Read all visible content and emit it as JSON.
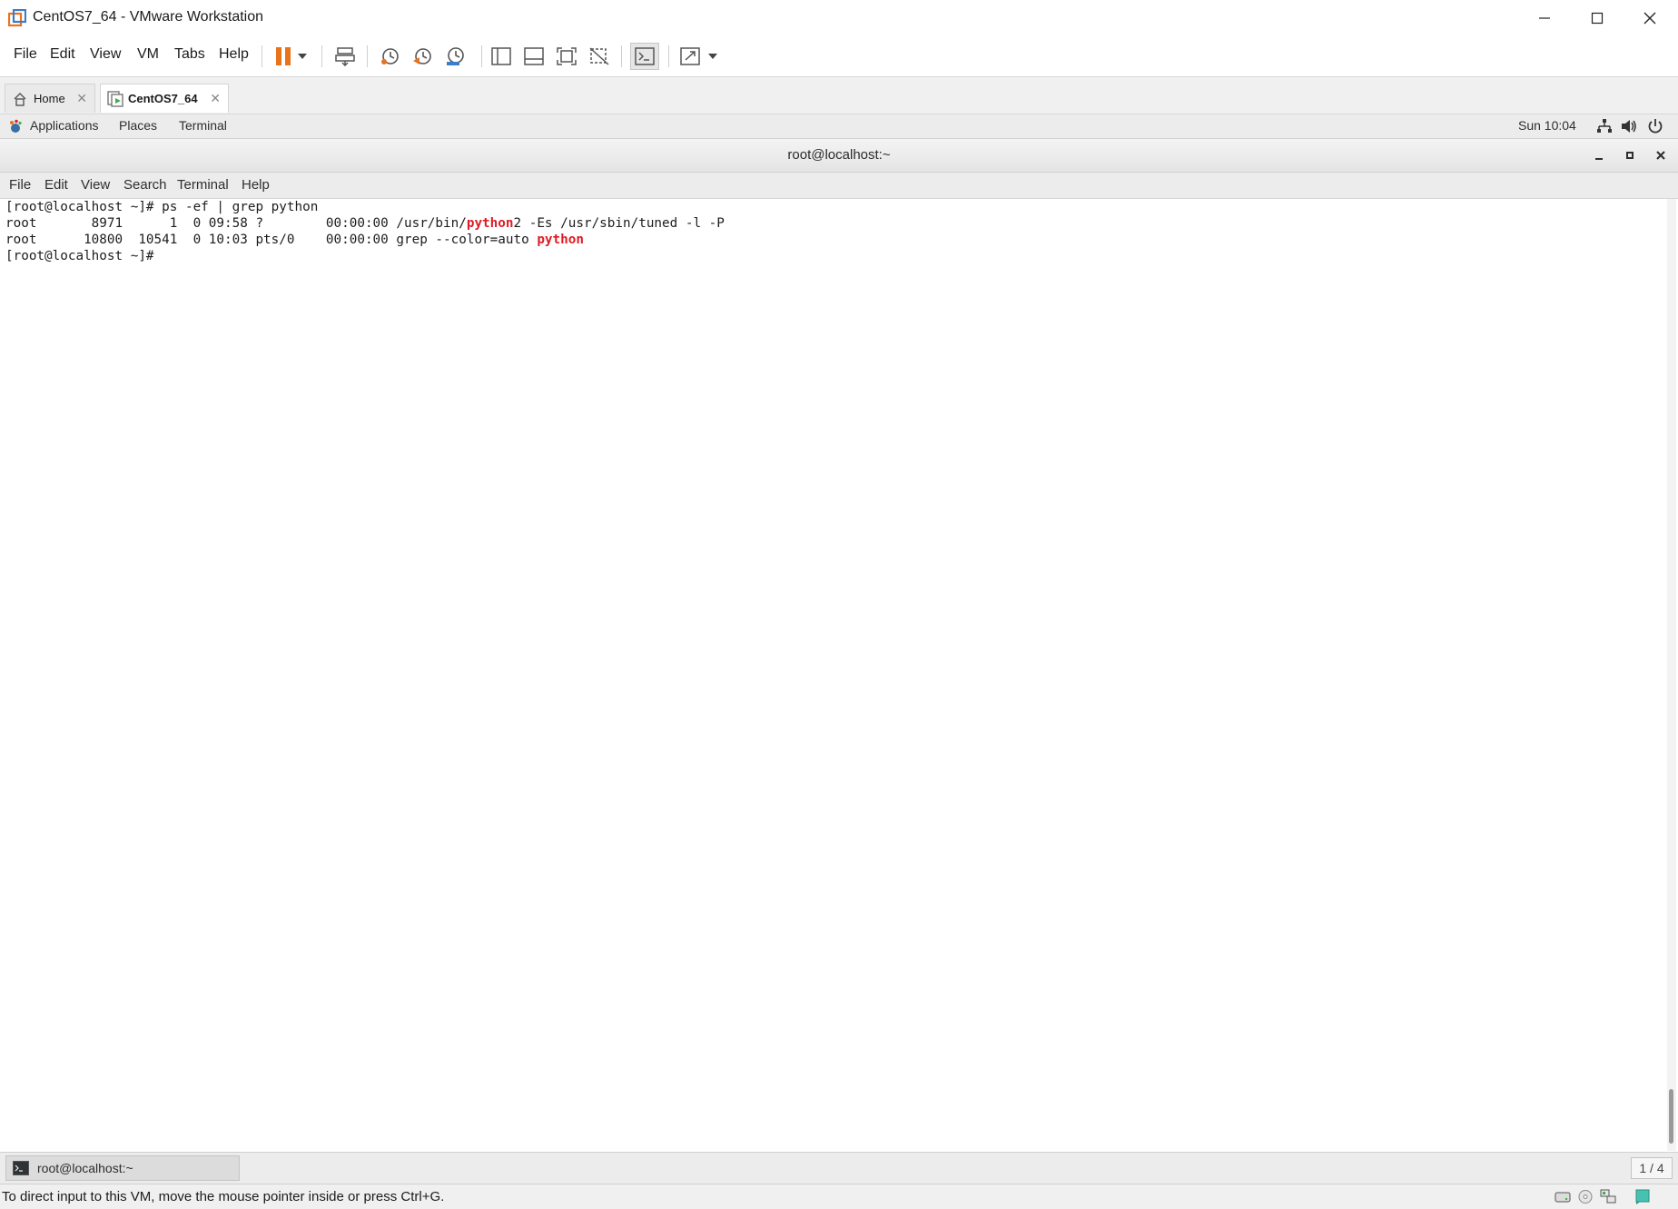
{
  "window": {
    "title": "CentOS7_64 - VMware Workstation"
  },
  "menu": [
    "File",
    "Edit",
    "View",
    "VM",
    "Tabs",
    "Help"
  ],
  "toolbar_icons": [
    "pause-icon",
    "dropdown-arrow-icon",
    "send-keys-icon",
    "snapshot-icon",
    "revert-snapshot-icon",
    "snapshot-manager-icon",
    "library-icon",
    "thumbnail-icon",
    "full-screen-icon",
    "unity-icon",
    "console-view-icon",
    "stretch-icon",
    "dropdown-arrow-icon"
  ],
  "tabs": [
    {
      "label": "Home",
      "icon": "home-icon",
      "active": false
    },
    {
      "label": "CentOS7_64",
      "icon": "vm-icon",
      "active": true
    }
  ],
  "gnome_panel": {
    "menus": [
      "Applications",
      "Places",
      "Terminal"
    ],
    "clock": "Sun 10:04",
    "tray_icons": [
      "network-icon",
      "volume-icon",
      "power-icon"
    ]
  },
  "terminal": {
    "title": "root@localhost:~",
    "menu": [
      "File",
      "Edit",
      "View",
      "Search",
      "Terminal",
      "Help"
    ],
    "lines": [
      [
        {
          "t": "[root@localhost ~]# ps -ef | grep python"
        }
      ],
      [
        {
          "t": "root       8971      1  0 09:58 ?        00:00:00 /usr/bin/"
        },
        {
          "t": "python",
          "hl": true
        },
        {
          "t": "2 -Es /usr/sbin/tuned -l -P"
        }
      ],
      [
        {
          "t": "root      10800  10541  0 10:03 pts/0    00:00:00 grep --color=auto "
        },
        {
          "t": "python",
          "hl": true
        }
      ],
      [
        {
          "t": "[root@localhost ~]# "
        }
      ]
    ],
    "highlight_color": "#e01b24"
  },
  "gnome_bottom": {
    "task_label": "root@localhost:~",
    "workspace": "1 / 4"
  },
  "statusbar": {
    "text": "To direct input to this VM, move the mouse pointer inside or press Ctrl+G.",
    "icons": [
      "hard-disk-icon",
      "cd-dvd-icon",
      "network-adapter-icon",
      "message-icon"
    ]
  },
  "colors": {
    "vmware_orange": "#e8731a",
    "accent_blue": "#3a7dc9"
  }
}
